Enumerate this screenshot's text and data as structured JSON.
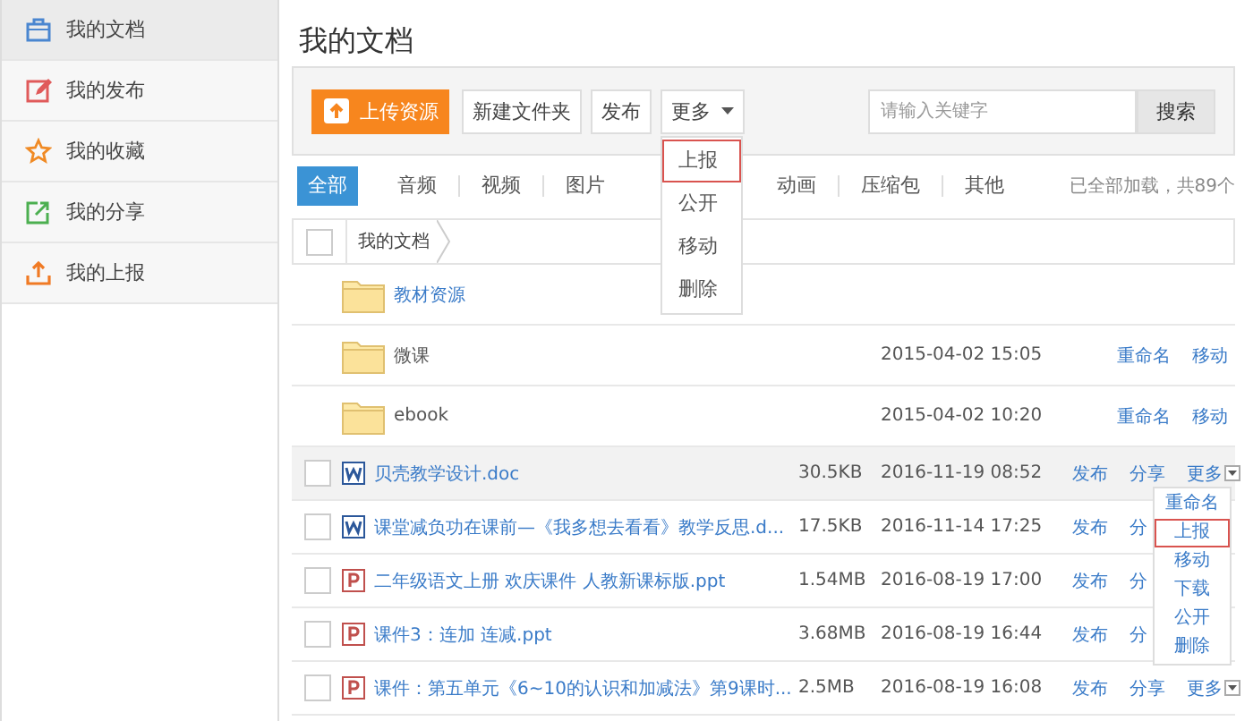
{
  "sidebar": {
    "items": [
      {
        "label": "我的文档",
        "selected": true
      },
      {
        "label": "我的发布",
        "selected": false
      },
      {
        "label": "我的收藏",
        "selected": false
      },
      {
        "label": "我的分享",
        "selected": false
      },
      {
        "label": "我的上报",
        "selected": false
      }
    ]
  },
  "page_title": "我的文档",
  "toolbar": {
    "upload_button": "上传资源",
    "buttons": [
      "新建文件夹",
      "发布"
    ],
    "more_button": "更多",
    "more_menu": [
      {
        "label": "上报",
        "selected": true
      },
      {
        "label": "公开",
        "selected": false
      },
      {
        "label": "移动",
        "selected": false
      },
      {
        "label": "删除",
        "selected": false
      }
    ],
    "search": {
      "placeholder": "请输入关键字",
      "button": "搜索"
    }
  },
  "tabs": [
    {
      "label": "全部",
      "selected": true
    },
    {
      "label": "音频",
      "selected": false
    },
    {
      "label": "视频",
      "selected": false
    },
    {
      "label": "图片",
      "selected": false
    },
    {
      "label": "动画",
      "selected": false
    },
    {
      "label": "压缩包",
      "selected": false
    },
    {
      "label": "其他",
      "selected": false
    }
  ],
  "load_status": "已全部加载，共89个",
  "breadcrumb": {
    "checked": false,
    "path": [
      "我的文档"
    ]
  },
  "rows": [
    {
      "kind": "folder",
      "name": "教材资源",
      "highlighted": true,
      "hovered": false
    },
    {
      "kind": "folder",
      "hovered": false,
      "name": "微课",
      "highlighted": false,
      "date": "2015-04-02 15:05",
      "actions": [
        {
          "label": "重命名",
          "kind": "link"
        },
        {
          "label": "移动",
          "kind": "link"
        }
      ]
    },
    {
      "kind": "folder",
      "hovered": false,
      "name": "ebook",
      "highlighted": false,
      "date": "2015-04-02 10:20",
      "actions": [
        {
          "label": "重命名",
          "kind": "link"
        },
        {
          "label": "移动",
          "kind": "link"
        }
      ]
    },
    {
      "kind": "word",
      "checked": false,
      "hovered": true,
      "name": "贝壳教学设计.doc",
      "size": "30.5KB",
      "date": "2016-11-19 08:52",
      "actions": [
        {
          "label": "发布",
          "kind": "link"
        },
        {
          "label": "分享",
          "kind": "link"
        },
        {
          "label": "更多",
          "kind": "more"
        }
      ],
      "menu": [
        {
          "label": "重命名",
          "selected": false
        },
        {
          "label": "上报",
          "selected": true
        },
        {
          "label": "移动",
          "selected": false
        },
        {
          "label": "下载",
          "selected": false
        },
        {
          "label": "公开",
          "selected": false
        },
        {
          "label": "删除",
          "selected": false
        }
      ]
    },
    {
      "kind": "word",
      "checked": false,
      "hovered": false,
      "name": "课堂减负功在课前—《我多想去看看》教学反思.d...",
      "size": "17.5KB",
      "date": "2016-11-14 17:25",
      "actions": [
        {
          "label": "发布",
          "kind": "link"
        },
        {
          "label": "分",
          "kind": "link"
        }
      ]
    },
    {
      "kind": "ppt",
      "checked": false,
      "hovered": false,
      "name": "二年级语文上册 欢庆课件 人教新课标版.ppt",
      "size": "1.54MB",
      "date": "2016-08-19 17:00",
      "actions": [
        {
          "label": "发布",
          "kind": "link"
        },
        {
          "label": "分",
          "kind": "link"
        }
      ]
    },
    {
      "kind": "ppt",
      "checked": false,
      "hovered": false,
      "name": "课件3：连加 连减.ppt",
      "size": "3.68MB",
      "date": "2016-08-19 16:44",
      "actions": [
        {
          "label": "发布",
          "kind": "link"
        },
        {
          "label": "分",
          "kind": "link"
        }
      ]
    },
    {
      "kind": "ppt",
      "checked": false,
      "hovered": false,
      "name": "课件：第五单元《6~10的认识和加减法》第9课时...",
      "size": "2.5MB",
      "date": "2016-08-19 16:08",
      "actions": [
        {
          "label": "发布",
          "kind": "link"
        },
        {
          "label": "分享",
          "kind": "link"
        },
        {
          "label": "更多",
          "kind": "more"
        }
      ]
    }
  ]
}
